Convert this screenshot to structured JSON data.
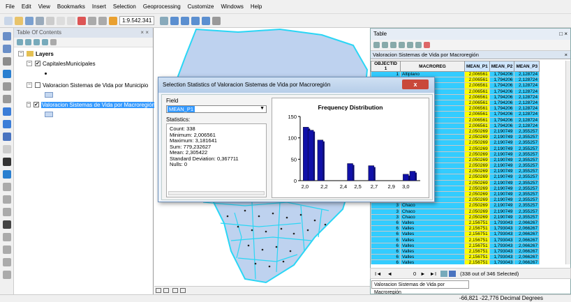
{
  "menu": [
    "File",
    "Edit",
    "View",
    "Bookmarks",
    "Insert",
    "Selection",
    "Geoprocessing",
    "Customize",
    "Windows",
    "Help"
  ],
  "toolbar": {
    "scale": "1:9.542.341"
  },
  "toc": {
    "title": "Table Of Contents",
    "close": "× ×",
    "layers_label": "Layers",
    "items": [
      {
        "label": "CapitalesMunicipales",
        "checked": "✔"
      },
      {
        "label": "Valoracion Sistemas de Vida por Municipio",
        "checked": ""
      },
      {
        "label": "Valoracion Sistemas de Vida por Macroregión",
        "checked": "✔"
      }
    ]
  },
  "table_window": {
    "title": "Table",
    "close": "□ ×",
    "tab_title": "Valoracion Sistemas de Vida por Macroregión",
    "columns": [
      "OBJECTID 1",
      "MACROREG",
      "MEAN_P1",
      "MEAN_P2",
      "MEAN_P3"
    ],
    "rows": [
      [
        "1",
        "Altiplano",
        "2,006561",
        "1,794206",
        "2,128724"
      ],
      [
        "1",
        "Altiplano",
        "2,006561",
        "1,794206",
        "2,128724"
      ],
      [
        "",
        "",
        "2,006561",
        "1,794206",
        "2,128724"
      ],
      [
        "",
        "",
        "2,006561",
        "1,794206",
        "2,128724"
      ],
      [
        "",
        "",
        "2,006561",
        "1,794206",
        "2,128724"
      ],
      [
        "",
        "",
        "2,006561",
        "1,794206",
        "2,128724"
      ],
      [
        "",
        "",
        "2,006561",
        "1,794206",
        "2,128724"
      ],
      [
        "",
        "",
        "2,006561",
        "1,794206",
        "2,128724"
      ],
      [
        "",
        "",
        "2,006561",
        "1,794206",
        "2,128724"
      ],
      [
        "",
        "",
        "2,006561",
        "1,794206",
        "2,128724"
      ],
      [
        "",
        "",
        "2,050269",
        "2,190749",
        "2,355257"
      ],
      [
        "",
        "",
        "2,050269",
        "2,190749",
        "2,355257"
      ],
      [
        "",
        "",
        "2,050269",
        "2,190749",
        "2,355257"
      ],
      [
        "",
        "",
        "2,050269",
        "2,190749",
        "2,355257"
      ],
      [
        "",
        "",
        "2,050269",
        "2,190749",
        "2,355257"
      ],
      [
        "",
        "",
        "2,050269",
        "2,190749",
        "2,355257"
      ],
      [
        "",
        "",
        "2,050269",
        "2,190749",
        "2,355257"
      ],
      [
        "",
        "",
        "2,050269",
        "2,190749",
        "2,355257"
      ],
      [
        "",
        "",
        "2,050269",
        "2,190749",
        "2,355257"
      ],
      [
        "",
        "",
        "2,050269",
        "2,190749",
        "2,355257"
      ],
      [
        "",
        "",
        "2,050269",
        "2,190749",
        "2,355257"
      ],
      [
        "",
        "",
        "2,050269",
        "2,190749",
        "2,355257"
      ],
      [
        "",
        "",
        "2,050269",
        "2,190749",
        "2,355257"
      ],
      [
        "3",
        "Chaco",
        "2,050269",
        "2,190749",
        "2,355257"
      ],
      [
        "3",
        "Chaco",
        "2,050269",
        "2,190749",
        "2,355257"
      ],
      [
        "3",
        "Chaco",
        "2,050269",
        "2,190749",
        "2,355257"
      ],
      [
        "6",
        "Valles",
        "2,156751",
        "1,793043",
        "2,066267"
      ],
      [
        "6",
        "Valles",
        "2,156751",
        "1,793043",
        "2,066267"
      ],
      [
        "6",
        "Valles",
        "2,156751",
        "1,793043",
        "2,066267"
      ],
      [
        "6",
        "Valles",
        "2,156751",
        "1,793043",
        "2,066267"
      ],
      [
        "6",
        "Valles",
        "2,156751",
        "1,793043",
        "2,066267"
      ],
      [
        "6",
        "Valles",
        "2,156751",
        "1,793043",
        "2,066267"
      ],
      [
        "6",
        "Valles",
        "2,156751",
        "1,793043",
        "2,066267"
      ],
      [
        "6",
        "Valles",
        "2,156751",
        "1,793043",
        "2,066267"
      ]
    ],
    "footer": "(338 out of 346 Selected)",
    "bottom_tab": "Valoracion Sistemas de Vida por Macroregión"
  },
  "dialog": {
    "title": "Selection Statistics of Valoracion Sistemas de Vida por Macroregión",
    "close": "x",
    "field_label": "Field",
    "field_value": "MEAN_P1",
    "stats_label": "Statistics:",
    "stats": [
      "Count:   338",
      "Minimum: 2,006561",
      "Maximum: 3,181641",
      "Sum:     779,232627",
      "Mean:    2,305422",
      "Standard Deviation: 0,367711",
      "Nulls:   0"
    ]
  },
  "chart_data": {
    "type": "bar",
    "title": "Frequency Distribution",
    "x_ticks": [
      "2,0",
      "2,2",
      "2,4",
      "2,5",
      "2,7",
      "2,9",
      "3,0"
    ],
    "y_ticks": [
      "150",
      "100",
      "50",
      "0"
    ],
    "ylim": [
      0,
      150
    ],
    "xlim": [
      1.95,
      3.2
    ],
    "bins": [
      {
        "x": 2.01,
        "value": 125
      },
      {
        "x": 2.06,
        "value": 118
      },
      {
        "x": 2.16,
        "value": 95
      },
      {
        "x": 2.47,
        "value": 40
      },
      {
        "x": 2.69,
        "value": 35
      },
      {
        "x": 3.05,
        "value": 15
      },
      {
        "x": 3.12,
        "value": 22
      }
    ],
    "bar_color": "#1010a8"
  },
  "status": {
    "coords": "-66,821  -22,776 Decimal Degrees"
  }
}
